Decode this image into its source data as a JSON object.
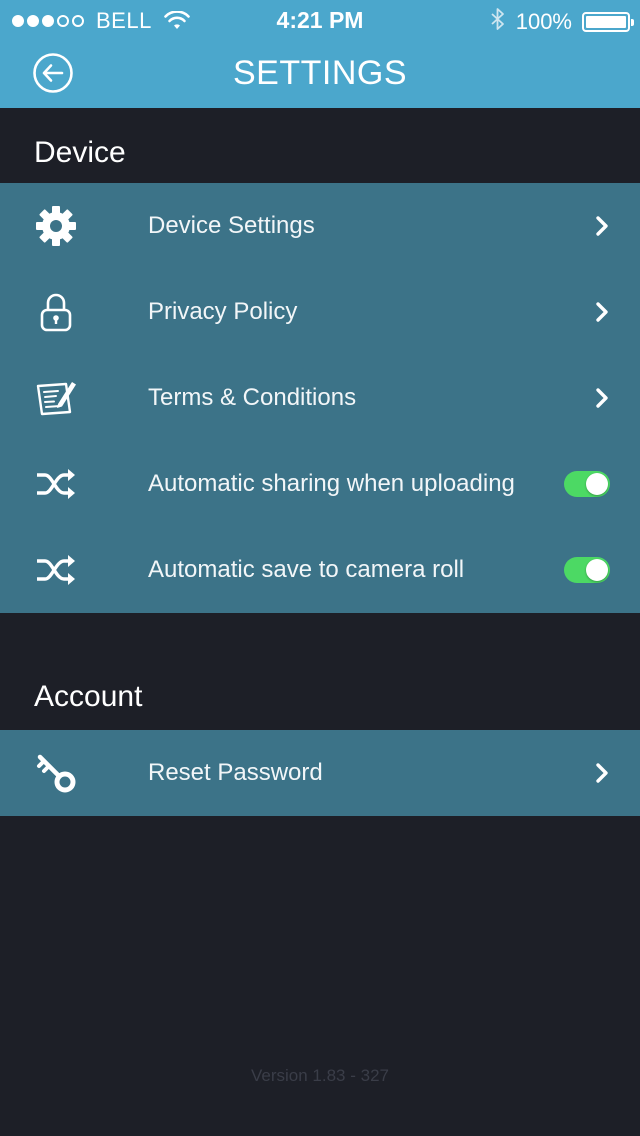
{
  "status_bar": {
    "carrier": "BELL",
    "time": "4:21 PM",
    "battery": "100%",
    "signal_icon": "signal-dots-icon",
    "wifi_icon": "wifi-icon",
    "bluetooth_icon": "bluetooth-icon"
  },
  "nav": {
    "title": "SETTINGS",
    "back_icon": "back-arrow-icon"
  },
  "sections": [
    {
      "title": "Device",
      "rows": [
        {
          "label": "Device Settings",
          "icon": "gear-icon",
          "accessory": "chevron"
        },
        {
          "label": "Privacy Policy",
          "icon": "lock-icon",
          "accessory": "chevron"
        },
        {
          "label": "Terms & Conditions",
          "icon": "document-edit-icon",
          "accessory": "chevron"
        },
        {
          "label": "Automatic sharing when uploading",
          "icon": "shuffle-icon",
          "accessory": "toggle",
          "on": true
        },
        {
          "label": "Automatic save to camera roll",
          "icon": "shuffle-icon",
          "accessory": "toggle",
          "on": true
        }
      ]
    },
    {
      "title": "Account",
      "rows": [
        {
          "label": "Reset Password",
          "icon": "key-icon",
          "accessory": "chevron"
        }
      ]
    }
  ],
  "footer": {
    "version": "Version 1.83 - 327"
  },
  "colors": {
    "header": "#4ba7cc",
    "background": "#1d1f27",
    "row": "#3c7388",
    "toggle_on": "#4cd964"
  }
}
